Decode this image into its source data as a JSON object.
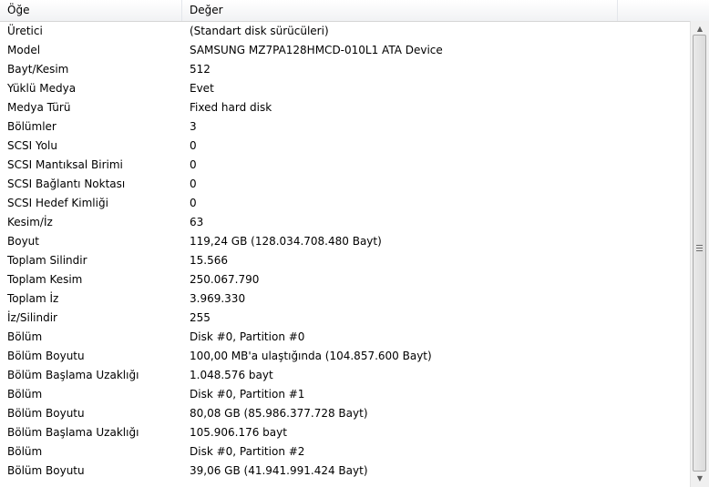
{
  "columns": {
    "item": "Öğe",
    "value": "Değer"
  },
  "rows": [
    {
      "item": "Üretici",
      "value": "(Standart disk sürücüleri)"
    },
    {
      "item": "Model",
      "value": "SAMSUNG MZ7PA128HMCD-010L1 ATA Device"
    },
    {
      "item": "Bayt/Kesim",
      "value": "512"
    },
    {
      "item": "Yüklü Medya",
      "value": "Evet"
    },
    {
      "item": "Medya Türü",
      "value": "Fixed hard disk"
    },
    {
      "item": "Bölümler",
      "value": "3"
    },
    {
      "item": "SCSI Yolu",
      "value": "0"
    },
    {
      "item": "SCSI Mantıksal Birimi",
      "value": "0"
    },
    {
      "item": "SCSI Bağlantı Noktası",
      "value": "0"
    },
    {
      "item": "SCSI Hedef Kimliği",
      "value": "0"
    },
    {
      "item": "Kesim/İz",
      "value": "63"
    },
    {
      "item": "Boyut",
      "value": "119,24 GB (128.034.708.480 Bayt)"
    },
    {
      "item": "Toplam Silindir",
      "value": "15.566"
    },
    {
      "item": "Toplam Kesim",
      "value": "250.067.790"
    },
    {
      "item": "Toplam İz",
      "value": "3.969.330"
    },
    {
      "item": "İz/Silindir",
      "value": "255"
    },
    {
      "item": "Bölüm",
      "value": "Disk #0, Partition #0"
    },
    {
      "item": "Bölüm Boyutu",
      "value": "100,00 MB'a ulaştığında (104.857.600 Bayt)"
    },
    {
      "item": "Bölüm Başlama Uzaklığı",
      "value": "1.048.576 bayt"
    },
    {
      "item": "Bölüm",
      "value": "Disk #0, Partition #1"
    },
    {
      "item": "Bölüm Boyutu",
      "value": "80,08 GB (85.986.377.728 Bayt)"
    },
    {
      "item": "Bölüm Başlama Uzaklığı",
      "value": "105.906.176 bayt"
    },
    {
      "item": "Bölüm",
      "value": "Disk #0, Partition #2"
    },
    {
      "item": "Bölüm Boyutu",
      "value": "39,06 GB (41.941.991.424 Bayt)"
    }
  ],
  "scrollbar": {
    "up_icon": "chevron-up-icon",
    "down_icon": "chevron-down-icon",
    "position": 0
  }
}
